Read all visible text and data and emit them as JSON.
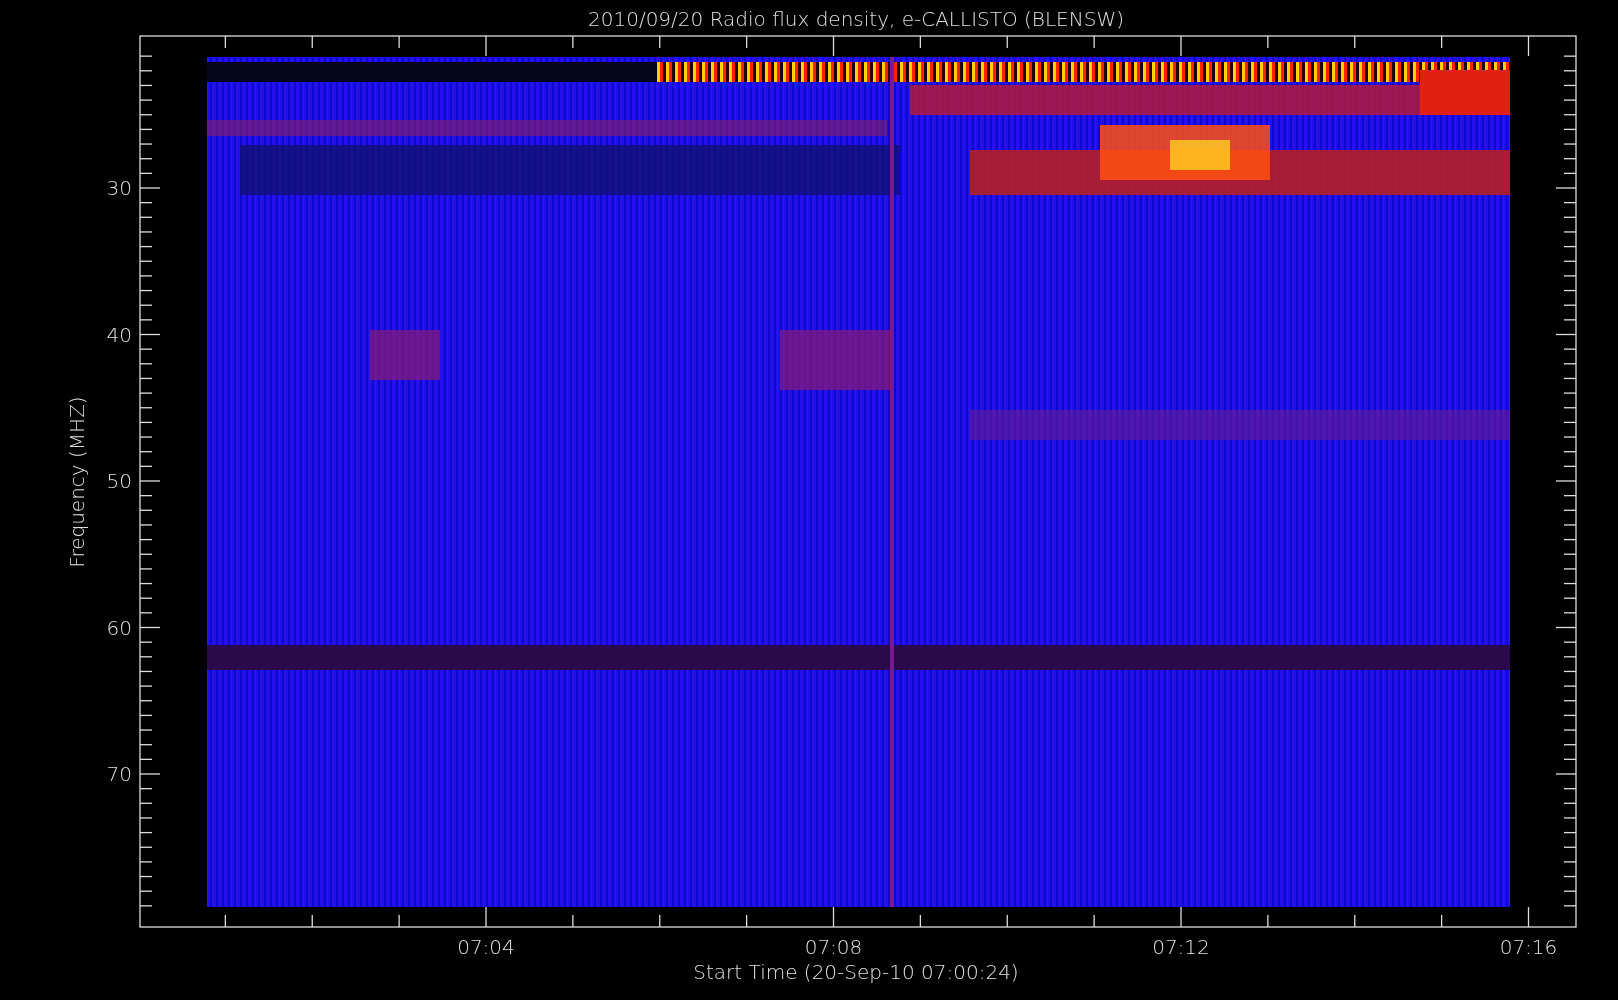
{
  "title": "2010/09/20  Radio flux density, e-CALLISTO (BLENSW)",
  "y_axis": {
    "label": "Frequency (MHZ)",
    "ticks": [
      "30",
      "40",
      "50",
      "60",
      "70"
    ]
  },
  "x_axis": {
    "label": "Start Time (20-Sep-10 07:00:24)",
    "ticks": [
      "07:04",
      "07:08",
      "07:12",
      "07:16"
    ]
  }
}
